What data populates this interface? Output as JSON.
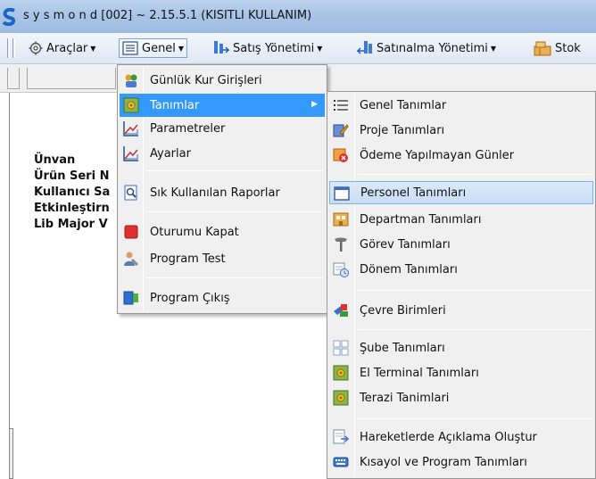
{
  "window": {
    "title": "s y s m o n d  [002] ~ 2.15.5.1  (KISITLI KULLANIM)"
  },
  "toolbar": {
    "items": [
      {
        "label": "Araçlar",
        "icon": "gear-icon"
      },
      {
        "label": "Genel",
        "icon": "list-icon"
      },
      {
        "label": "Satış Yönetimi",
        "icon": "sales-icon"
      },
      {
        "label": "Satınalma Yönetimi",
        "icon": "purchase-icon"
      },
      {
        "label": "Stok",
        "icon": "stock-icon"
      }
    ]
  },
  "background_labels": [
    "Ünvan",
    "Ürün Seri N",
    "Kullanıcı Sa",
    "Etkinleştirn",
    "Lib Major V"
  ],
  "menu_genel": {
    "items": [
      {
        "label": "Günlük Kur Girişleri",
        "icon": "people-money-icon"
      },
      {
        "label": "Tanımlar",
        "icon": "definitions-icon"
      },
      {
        "label": "Parametreler",
        "icon": "chart-icon"
      },
      {
        "label": "Ayarlar",
        "icon": "chart-icon"
      },
      {
        "label": "Sık Kullanılan Raporlar",
        "icon": "report-search-icon"
      },
      {
        "label": "Oturumu Kapat",
        "icon": "stop-icon"
      },
      {
        "label": "Program Test",
        "icon": "user-test-icon"
      },
      {
        "label": "Program Çıkış",
        "icon": "exit-icon"
      }
    ]
  },
  "menu_tanimlar": {
    "items": [
      {
        "label": "Genel Tanımlar",
        "icon": "list-icon"
      },
      {
        "label": "Proje Tanımları",
        "icon": "project-icon"
      },
      {
        "label": "Ödeme Yapılmayan Günler",
        "icon": "calendar-no-icon"
      },
      {
        "label": "Personel Tanımları",
        "icon": "window-icon"
      },
      {
        "label": "Departman Tanımları",
        "icon": "department-icon"
      },
      {
        "label": "Görev Tanımları",
        "icon": "tools-icon"
      },
      {
        "label": "Dönem Tanımları",
        "icon": "period-icon"
      },
      {
        "label": "Çevre Birimleri",
        "icon": "devices-icon"
      },
      {
        "label": "Şube Tanımları",
        "icon": "branch-icon"
      },
      {
        "label": "El Terminal Tanımları",
        "icon": "definitions-icon"
      },
      {
        "label": "Terazi Tanimlari",
        "icon": "definitions-icon"
      },
      {
        "label": "Hareketlerde Açıklama Oluştur",
        "icon": "describe-icon"
      },
      {
        "label": "Kısayol ve Program Tanımları",
        "icon": "keyboard-icon"
      }
    ]
  },
  "colors": {
    "highlight": "#3399ff",
    "menu_bg": "#f0f0f0",
    "titlebar": "#a9c4e6"
  }
}
